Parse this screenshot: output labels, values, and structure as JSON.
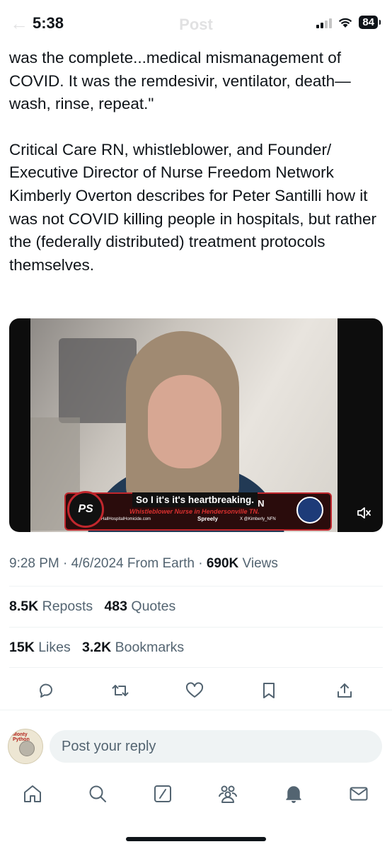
{
  "status": {
    "time": "5:38",
    "battery": "84"
  },
  "header": {
    "back_label": "←",
    "title": "Post"
  },
  "post": {
    "paragraph_1": "was the complete...medical mismanagement of COVID. It was the remdesivir, ventilator, death—wash, rinse, repeat.\"",
    "paragraph_2": "Critical Care RN, whistleblower, and Founder/ Executive Director of Nurse Freedom Network Kimberly Overton describes for Peter Santilli how it was not COVID killing people in hospitals, but rather the (federally distributed) treatment protocols themselves."
  },
  "video": {
    "caption": "So I it's it's heartbreaking.",
    "lower_third_name_left": "K",
    "lower_third_name_right": "ON",
    "lower_third_subtitle": "Whistleblower Nurse in Hendersonville TN.",
    "lower_third_website": "HallHospitalHomicide.com",
    "lower_third_brand": "Spreely",
    "lower_third_handle": "X @Kimberly_NFN",
    "logo_text": "PS",
    "mute_icon": "speaker-muted-icon"
  },
  "meta": {
    "time": "9:28 PM",
    "sep1": "·",
    "date": "4/6/2024",
    "source": "From Earth",
    "sep2": "·",
    "views_count": "690K",
    "views_label": "Views"
  },
  "stats": {
    "reposts_count": "8.5K",
    "reposts_label": "Reposts",
    "quotes_count": "483",
    "quotes_label": "Quotes",
    "likes_count": "15K",
    "likes_label": "Likes",
    "bookmarks_count": "3.2K",
    "bookmarks_label": "Bookmarks"
  },
  "actions": [
    "reply-icon",
    "repost-icon",
    "like-icon",
    "bookmark-icon",
    "share-icon"
  ],
  "reply": {
    "placeholder": "Post your reply",
    "avatar_text": "Monty Python"
  },
  "tabbar": [
    "home-icon",
    "search-icon",
    "grok-icon",
    "communities-icon",
    "notifications-icon",
    "messages-icon"
  ],
  "colors": {
    "text": "#0f1419",
    "secondary": "#536471",
    "divider": "#eff3f4",
    "accent_red": "#c1272d"
  }
}
